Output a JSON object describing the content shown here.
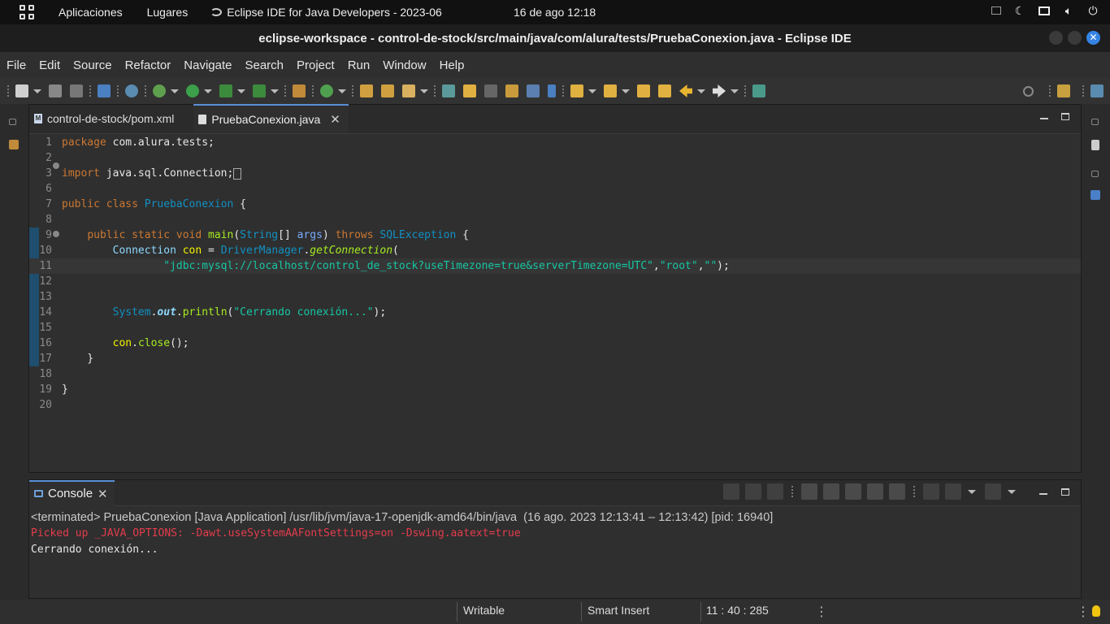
{
  "topbar": {
    "applications": "Aplicaciones",
    "places": "Lugares",
    "app_name": "Eclipse IDE for Java Developers - 2023-06",
    "datetime": "16 de ago  12:18"
  },
  "window": {
    "title": "eclipse-workspace - control-de-stock/src/main/java/com/alura/tests/PruebaConexion.java - Eclipse IDE"
  },
  "menu": [
    "File",
    "Edit",
    "Source",
    "Refactor",
    "Navigate",
    "Search",
    "Project",
    "Run",
    "Window",
    "Help"
  ],
  "editor": {
    "tabs": [
      {
        "label": "control-de-stock/pom.xml",
        "active": false
      },
      {
        "label": "PruebaConexion.java",
        "active": true
      }
    ],
    "line_numbers": [
      "1",
      "2",
      "3",
      "6",
      "7",
      "8",
      "9",
      "10",
      "11",
      "12",
      "13",
      "14",
      "15",
      "16",
      "17",
      "18",
      "19",
      "20"
    ],
    "lines": [
      {
        "n": "1",
        "text": "package com.alura.tests;"
      },
      {
        "n": "2",
        "text": ""
      },
      {
        "n": "3",
        "text": "import java.sql.Connection;"
      },
      {
        "n": "6",
        "text": ""
      },
      {
        "n": "7",
        "text": "public class PruebaConexion {"
      },
      {
        "n": "8",
        "text": ""
      },
      {
        "n": "9",
        "text": "    public static void main(String[] args) throws SQLException {"
      },
      {
        "n": "10",
        "text": "        Connection con = DriverManager.getConnection("
      },
      {
        "n": "11",
        "text": "                \"jdbc:mysql://localhost/control_de_stock?useTimezone=true&serverTimezone=UTC\",\"root\",\"\");"
      },
      {
        "n": "12",
        "text": ""
      },
      {
        "n": "13",
        "text": ""
      },
      {
        "n": "14",
        "text": "        System.out.println(\"Cerrando conexión...\");"
      },
      {
        "n": "15",
        "text": ""
      },
      {
        "n": "16",
        "text": "        con.close();"
      },
      {
        "n": "17",
        "text": "    }"
      },
      {
        "n": "18",
        "text": ""
      },
      {
        "n": "19",
        "text": "}"
      },
      {
        "n": "20",
        "text": ""
      }
    ]
  },
  "console": {
    "tab_label": "Console",
    "terminated_line": "<terminated> PruebaConexion [Java Application] /usr/lib/jvm/java-17-openjdk-amd64/bin/java  (16 ago. 2023 12:13:41 – 12:13:42) [pid: 16940]",
    "stderr_line": "Picked up _JAVA_OPTIONS: -Dawt.useSystemAAFontSettings=on -Dswing.aatext=true",
    "stdout_line": "Cerrando conexión..."
  },
  "status": {
    "writable": "Writable",
    "insert_mode": "Smart Insert",
    "position": "11 : 40 : 285"
  },
  "colors": {
    "keyword": "#cc7832",
    "class": "#1290c3",
    "string": "#17c6a3",
    "method": "#a7ec21",
    "error": "#e43c4c",
    "accent": "#3584e4"
  }
}
